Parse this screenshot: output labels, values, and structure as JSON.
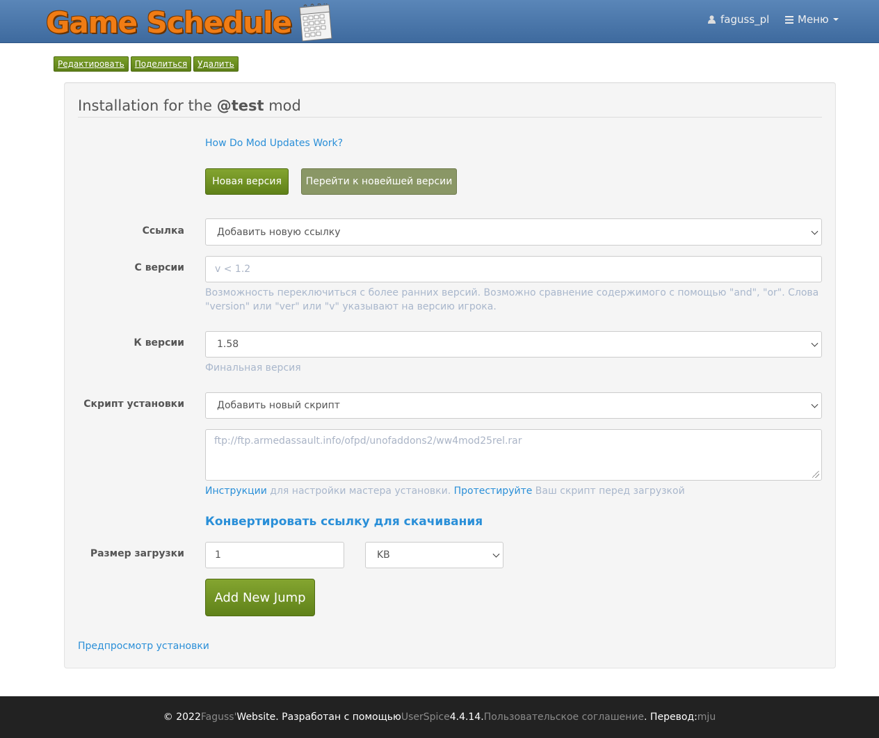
{
  "header": {
    "brand": "Game Schedule",
    "user": "faguss_pl",
    "menu_label": "Меню"
  },
  "actions": {
    "edit": "Редактировать",
    "share": "Поделиться",
    "delete": "Удалить"
  },
  "panel": {
    "title_prefix": "Installation for the ",
    "title_mod": "@test",
    "title_suffix": " mod",
    "updates_link": "How Do Mod Updates Work?",
    "new_version_btn": "Новая версия",
    "goto_latest_btn": "Перейти к новейшей версии"
  },
  "form": {
    "link_label": "Ссылка",
    "link_value": "Добавить новую ссылку",
    "from_label": "С версии",
    "from_placeholder": "v < 1.2",
    "from_help": "Возможность переключиться с более ранних версий. Возможно сравнение содержимого с помощью \"and\", \"or\". Слова \"version\" или \"ver\" или \"v\" указывают на версию игрока.",
    "to_label": "К версии",
    "to_value": "1.58",
    "to_help": "Финальная версия",
    "script_label": "Скрипт установки",
    "script_value": "Добавить новый скрипт",
    "script_placeholder": "ftp://ftp.armedassault.info/ofpd/unofaddons2/ww4mod25rel.rar",
    "instr_link": "Инструкции",
    "instr_text": " для настройки мастера установки. ",
    "test_link": "Протестируйте",
    "test_text": " Ваш скрипт перед загрузкой",
    "convert_link": "Конвертировать ссылку для скачивания",
    "size_label": "Размер загрузки",
    "size_value": "1",
    "size_unit": "KB",
    "add_jump_btn": "Add New Jump",
    "preview_link": "Предпросмотр установки"
  },
  "footer": {
    "copyright": "© 2022 ",
    "owner": "Faguss'",
    "text1": " Website. Разработан с помощью ",
    "userspice": "UserSpice",
    "version": " 4.4.14. ",
    "agreement": "Пользовательское соглашение",
    "text2": ". Перевод: ",
    "translator": "mju"
  },
  "colors": {
    "navbar": "#4a78ad",
    "brand": "#f07c14",
    "primary_btn": "#6f9122",
    "link": "#2a8fd8",
    "footer": "#222222"
  }
}
